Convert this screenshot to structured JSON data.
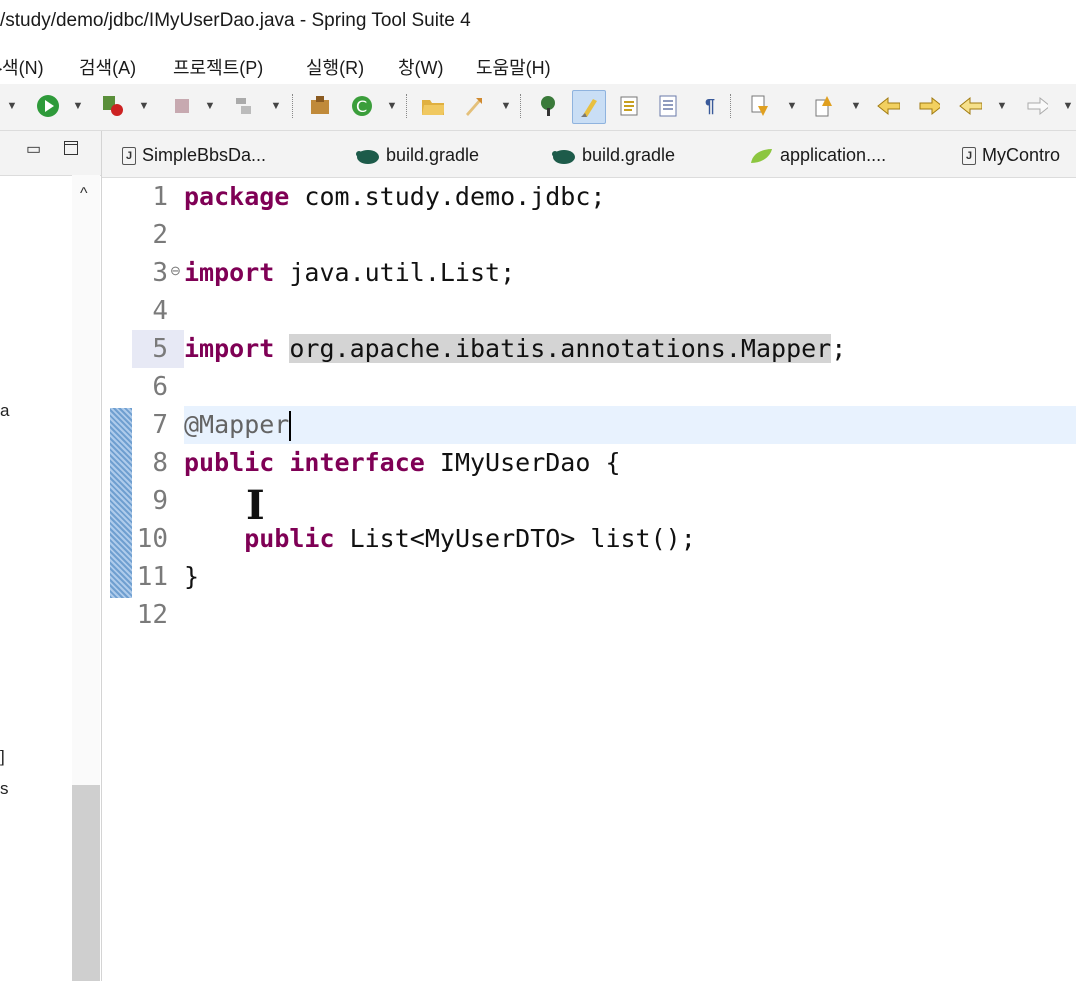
{
  "window": {
    "title": "/study/demo/jdbc/IMyUserDao.java - Spring Tool Suite 4"
  },
  "menu": {
    "items": [
      "}색(N)",
      "검색(A)",
      "프로젝트(P)",
      "실행(R)",
      "창(W)",
      "도움말(H)"
    ]
  },
  "toolbar": {
    "icons": [
      "play-icon",
      "debug-icon",
      "stop-icon",
      "deploy-icon",
      "new-package-icon",
      "refresh-icon",
      "open-folder-icon",
      "rocket-icon",
      "pin-icon",
      "brush-icon",
      "toggle-icon",
      "block-icon",
      "pilcrow-icon",
      "next-annotation-icon",
      "prev-annotation-icon",
      "back-edit-icon",
      "forward-edit-icon",
      "back-icon",
      "forward-icon"
    ]
  },
  "left_panel": {
    "fragments": [
      "a",
      "]",
      "s"
    ]
  },
  "tabs": [
    {
      "label": "SimpleBbsDa...",
      "icon": "java-file-icon"
    },
    {
      "label": "build.gradle",
      "icon": "gradle-icon"
    },
    {
      "label": "build.gradle",
      "icon": "gradle-icon"
    },
    {
      "label": "application....",
      "icon": "spring-leaf-icon"
    },
    {
      "label": "MyContro",
      "icon": "java-file-icon"
    }
  ],
  "editor": {
    "line_numbers": [
      "1",
      "2",
      "3",
      "4",
      "5",
      "6",
      "7",
      "8",
      "9",
      "10",
      "11",
      "12"
    ],
    "lines": [
      {
        "no": "1",
        "parts": [
          {
            "t": "package",
            "c": "kw"
          },
          {
            "t": " com.study.demo.jdbc;",
            "c": ""
          }
        ]
      },
      {
        "no": "2",
        "parts": []
      },
      {
        "no": "3",
        "parts": [
          {
            "t": "import",
            "c": "kw"
          },
          {
            "t": " java.util.List;",
            "c": ""
          }
        ]
      },
      {
        "no": "4",
        "parts": []
      },
      {
        "no": "5",
        "parts": [
          {
            "t": "import",
            "c": "kw"
          },
          {
            "t": " ",
            "c": ""
          },
          {
            "t": "org.apache.ibatis.annotations.Mapper",
            "c": "occ"
          },
          {
            "t": ";",
            "c": ""
          }
        ]
      },
      {
        "no": "6",
        "parts": []
      },
      {
        "no": "7",
        "parts": [
          {
            "t": "@Mapper",
            "c": "ann"
          }
        ]
      },
      {
        "no": "8",
        "parts": [
          {
            "t": "public",
            "c": "kw"
          },
          {
            "t": " ",
            "c": ""
          },
          {
            "t": "interface",
            "c": "kw"
          },
          {
            "t": " IMyUserDao {",
            "c": ""
          }
        ]
      },
      {
        "no": "9",
        "parts": []
      },
      {
        "no": "10",
        "parts": [
          {
            "t": "    ",
            "c": ""
          },
          {
            "t": "public",
            "c": "kw"
          },
          {
            "t": " List<MyUserDTO> list();",
            "c": ""
          }
        ]
      },
      {
        "no": "11",
        "parts": [
          {
            "t": "}",
            "c": ""
          }
        ]
      },
      {
        "no": "12",
        "parts": []
      }
    ],
    "fold_marker": "⊖"
  }
}
